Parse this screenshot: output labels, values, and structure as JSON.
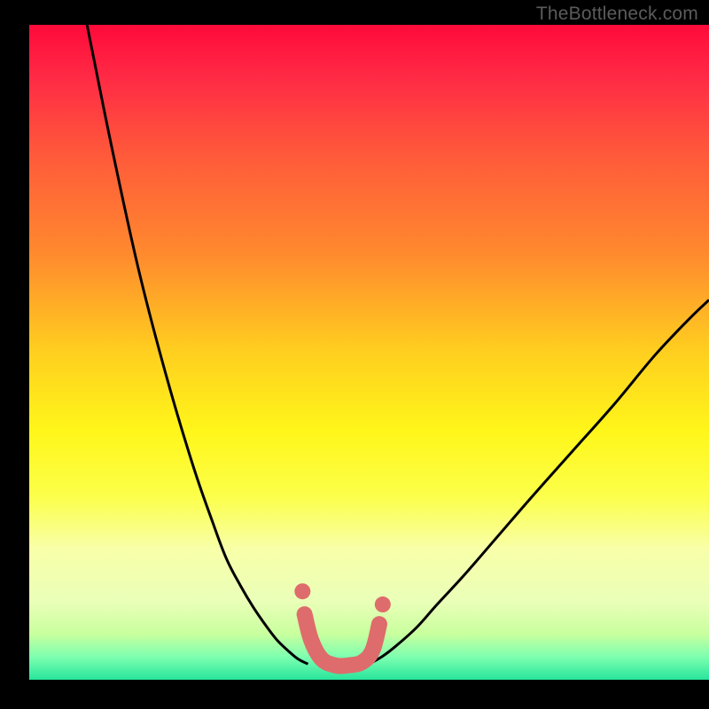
{
  "watermark": "TheBottleneck.com",
  "chart_data": {
    "type": "line",
    "title": "",
    "xlabel": "",
    "ylabel": "",
    "xlim": [
      0,
      100
    ],
    "ylim": [
      0,
      100
    ],
    "gradient_stops": [
      {
        "offset": 0.0,
        "color": "#ff0a3a"
      },
      {
        "offset": 0.08,
        "color": "#ff2a45"
      },
      {
        "offset": 0.2,
        "color": "#ff5a3a"
      },
      {
        "offset": 0.35,
        "color": "#ff8a2e"
      },
      {
        "offset": 0.5,
        "color": "#ffcf1f"
      },
      {
        "offset": 0.62,
        "color": "#fff61a"
      },
      {
        "offset": 0.72,
        "color": "#fcff4a"
      },
      {
        "offset": 0.8,
        "color": "#f8ffa8"
      },
      {
        "offset": 0.88,
        "color": "#eaffb8"
      },
      {
        "offset": 0.93,
        "color": "#c9ff9e"
      },
      {
        "offset": 0.965,
        "color": "#7dffb0"
      },
      {
        "offset": 1.0,
        "color": "#28e59c"
      }
    ],
    "series": [
      {
        "name": "left-curve",
        "stroke": "#000000",
        "stroke_width": 3,
        "x": [
          8.5,
          12,
          16,
          20,
          24,
          27,
          29,
          31,
          33,
          35,
          36.5,
          38,
          39.5,
          41
        ],
        "y": [
          100,
          82,
          63,
          47,
          33,
          24,
          18.5,
          14.5,
          11,
          8,
          6,
          4.5,
          3.2,
          2.4
        ]
      },
      {
        "name": "right-curve",
        "stroke": "#000000",
        "stroke_width": 3,
        "x": [
          50,
          52,
          54,
          57,
          60,
          64,
          69,
          74,
          80,
          86,
          92,
          97,
          100
        ],
        "y": [
          2.4,
          3.6,
          5.2,
          8,
          11.5,
          16,
          22,
          28,
          35,
          42,
          49.5,
          55,
          58
        ]
      },
      {
        "name": "bottom-band",
        "stroke": "#de6c6c",
        "stroke_width": 18,
        "linecap": "round",
        "x": [
          40.5,
          41.5,
          43,
          45,
          47,
          49,
          50.5,
          51.5
        ],
        "y": [
          10,
          6,
          3.2,
          2.2,
          2.2,
          2.7,
          4.5,
          8.5
        ]
      },
      {
        "name": "left-dot-upper",
        "type": "dot",
        "fill": "#de6c6c",
        "r": 9,
        "x": [
          40.2
        ],
        "y": [
          13.5
        ]
      },
      {
        "name": "right-dot-upper",
        "type": "dot",
        "fill": "#de6c6c",
        "r": 9,
        "x": [
          52.0
        ],
        "y": [
          11.5
        ]
      }
    ]
  }
}
